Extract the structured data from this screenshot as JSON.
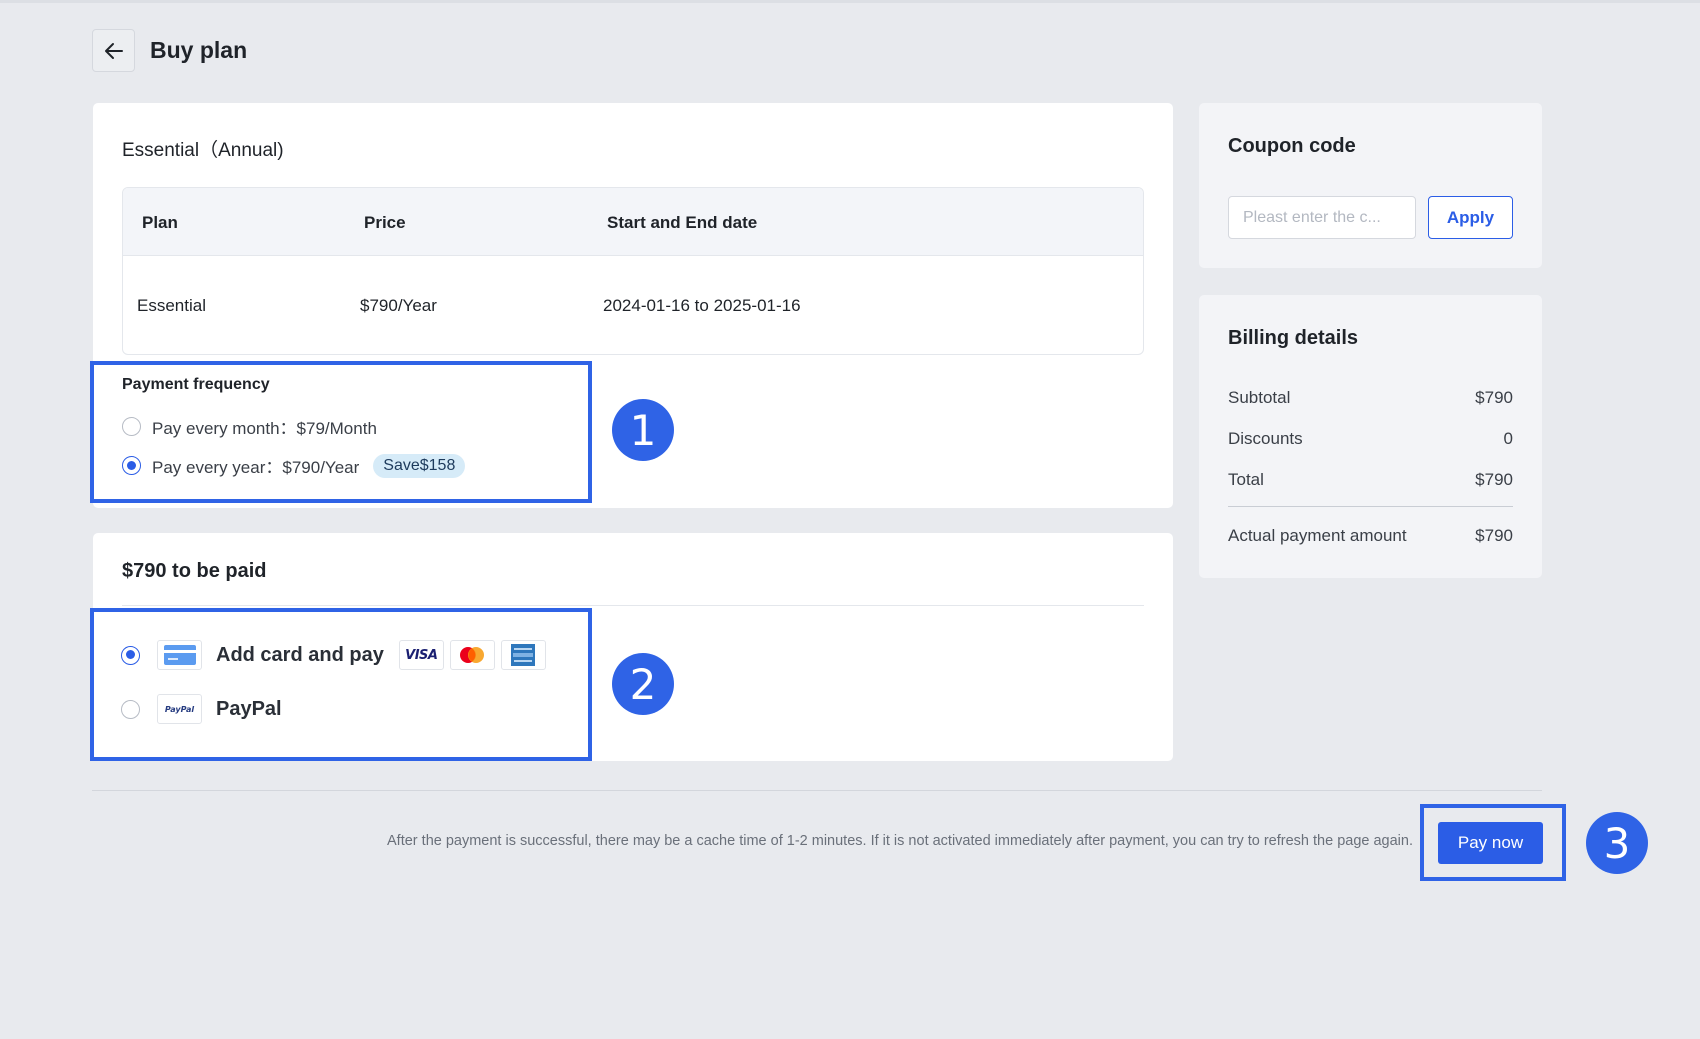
{
  "header": {
    "title": "Buy plan",
    "back_icon": "arrow-left-icon"
  },
  "plan": {
    "name": "Essential（Annual)",
    "table": {
      "headers": [
        "Plan",
        "Price",
        "Start and End date"
      ],
      "row": [
        "Essential",
        "$790/Year",
        "2024-01-16 to 2025-01-16"
      ]
    },
    "frequency": {
      "title": "Payment frequency",
      "options": [
        {
          "label": "Pay every month：$79/Month",
          "selected": false
        },
        {
          "label": "Pay every year：$790/Year",
          "selected": true,
          "badge": "Save$158"
        }
      ]
    }
  },
  "payment": {
    "title": "$790 to be paid",
    "methods": [
      {
        "label": "Add card and pay",
        "selected": true,
        "icon": "credit-card-icon",
        "brands": [
          "VISA",
          "mastercard",
          "amex"
        ]
      },
      {
        "label": "PayPal",
        "selected": false,
        "icon": "paypal-icon",
        "icon_text": "PayPal"
      }
    ]
  },
  "coupon": {
    "title": "Coupon code",
    "placeholder": "Pleast enter the c...",
    "apply_label": "Apply"
  },
  "billing": {
    "title": "Billing details",
    "rows": [
      {
        "label": "Subtotal",
        "value": "$790"
      },
      {
        "label": "Discounts",
        "value": "0"
      },
      {
        "label": "Total",
        "value": "$790"
      }
    ],
    "actual": {
      "label": "Actual payment amount",
      "value": "$790"
    }
  },
  "footer": {
    "note": "After the payment is successful, there may be a cache time of 1-2 minutes. If it is not activated immediately after payment, you can try to refresh the page again.",
    "pay_now_label": "Pay now"
  },
  "annotations": [
    "1",
    "2",
    "3"
  ],
  "colors": {
    "accent": "#2b5de6",
    "annotation": "#2f63e6",
    "badge_bg": "#d6ebf8",
    "background": "#e8eaee"
  }
}
